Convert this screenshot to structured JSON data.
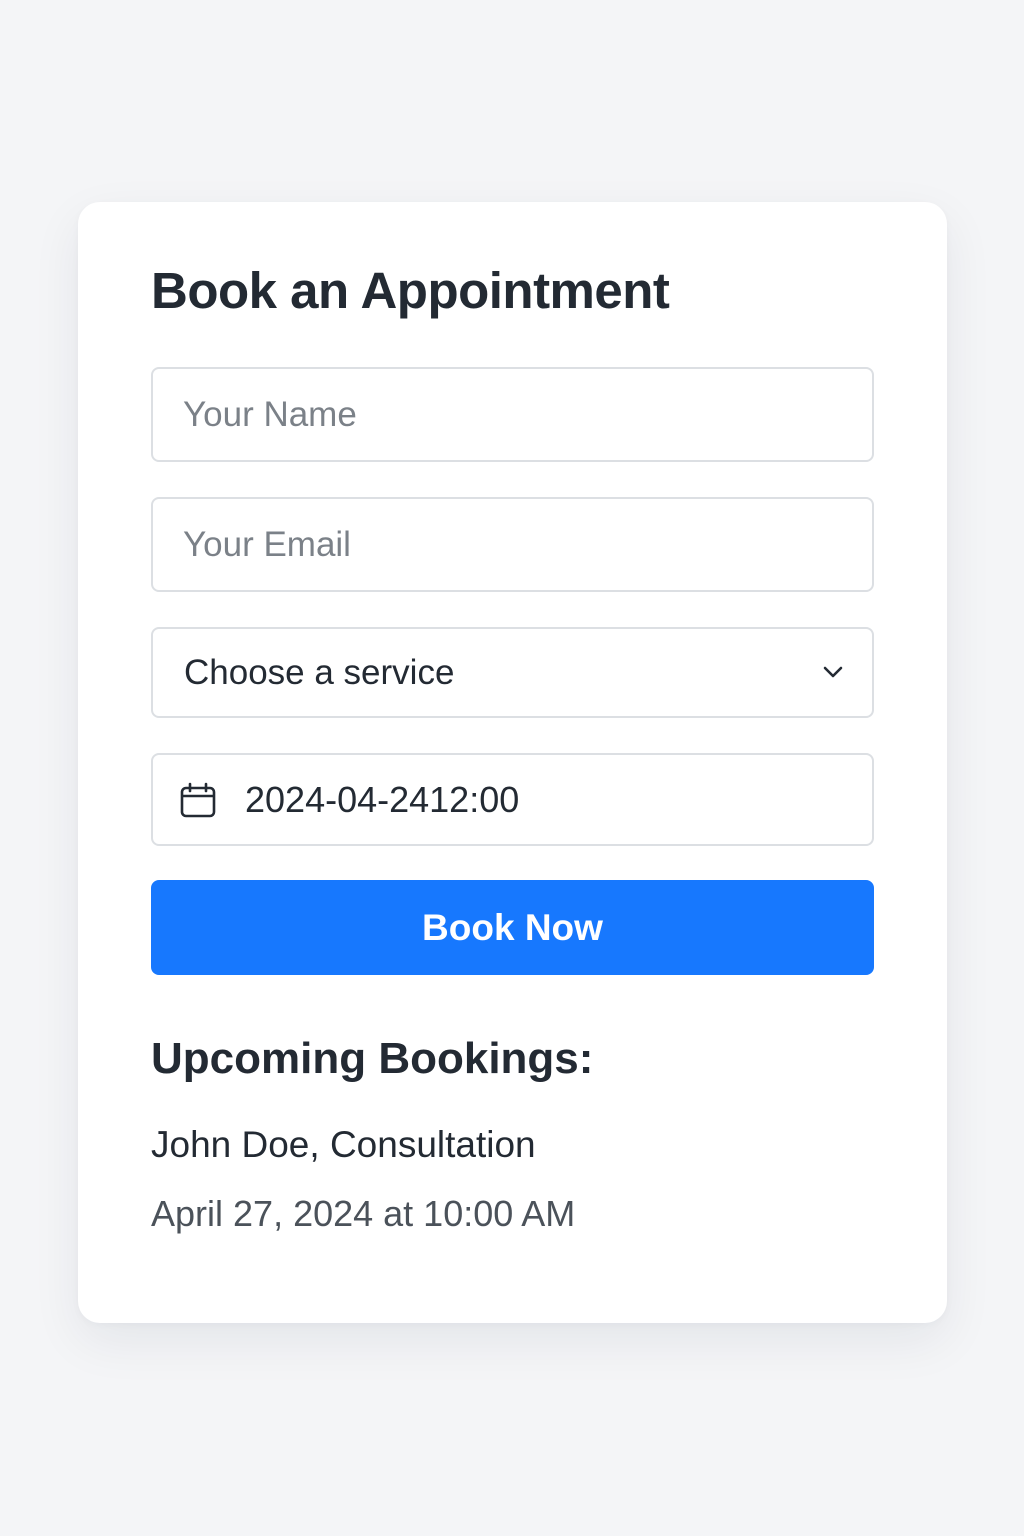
{
  "form": {
    "title": "Book an Appointment",
    "name_placeholder": "Your Name",
    "email_placeholder": "Your Email",
    "service_selected": "Choose a service",
    "datetime_value": "2024-04-2412:00",
    "submit_label": "Book Now"
  },
  "bookings": {
    "heading": "Upcoming Bookings:",
    "items": [
      {
        "name_service": "John Doe, Consultation",
        "when": "April 27, 2024 at 10:00 AM"
      }
    ]
  },
  "icons": {
    "service_dropdown": "chevron-down-icon",
    "datetime": "calendar-icon"
  },
  "colors": {
    "page_background": "#f4f5f7",
    "card_background": "#ffffff",
    "accent": "#1778fe",
    "text_primary": "#232a33",
    "text_placeholder": "#7b8188",
    "border": "#dcdfe3"
  }
}
